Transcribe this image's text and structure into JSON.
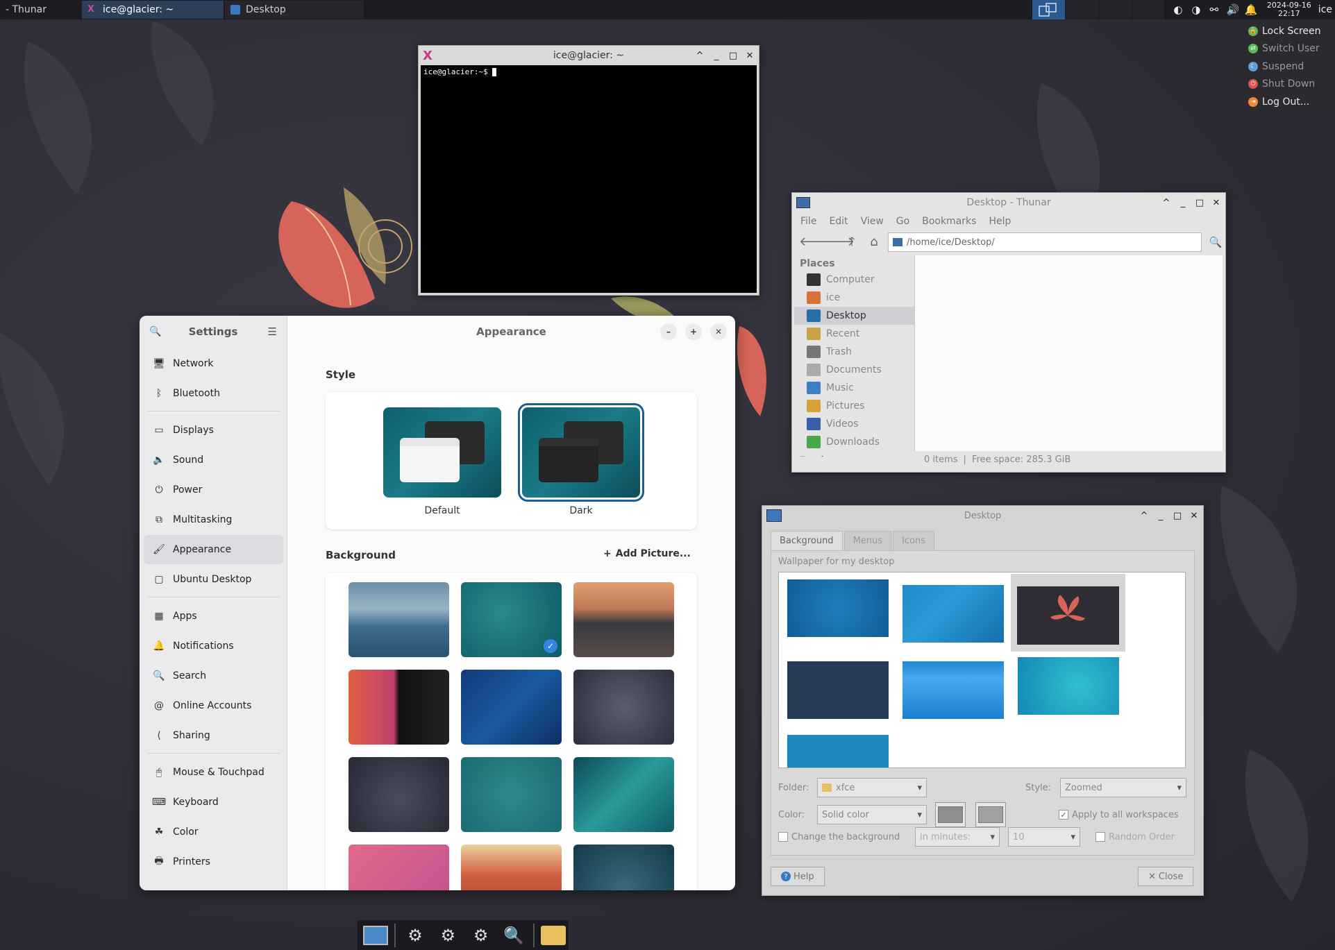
{
  "panel": {
    "tasks": [
      {
        "label": "- Thunar",
        "active": false
      },
      {
        "label": "ice@glacier: ~",
        "active": true
      },
      {
        "label": "Desktop",
        "active": false
      }
    ],
    "clock_date": "2024-09-16",
    "clock_time": "22:17",
    "user": "ice",
    "action_menu": [
      {
        "label": "Lock Screen",
        "color": "#5cb85c",
        "dim": false
      },
      {
        "label": "Switch User",
        "color": "#5cb85c",
        "dim": true
      },
      {
        "label": "Suspend",
        "color": "#5aa0d8",
        "dim": true
      },
      {
        "label": "Shut Down",
        "color": "#d9534f",
        "dim": true
      },
      {
        "label": "Log Out...",
        "color": "#f0883a",
        "dim": false
      }
    ]
  },
  "terminal": {
    "title": "ice@glacier: ~",
    "prompt": "ice@glacier:~$ "
  },
  "thunar": {
    "title": "Desktop - Thunar",
    "menu": [
      "File",
      "Edit",
      "View",
      "Go",
      "Bookmarks",
      "Help"
    ],
    "location": "/home/ice/Desktop/",
    "places_header": "Places",
    "places": [
      {
        "label": "Computer",
        "color": "#333",
        "icon": "computer-icon"
      },
      {
        "label": "ice",
        "color": "#d8743a",
        "icon": "home-icon"
      },
      {
        "label": "Desktop",
        "color": "#2a6ea8",
        "icon": "desktop-icon",
        "selected": true
      },
      {
        "label": "Recent",
        "color": "#c9a24a",
        "icon": "recent-icon"
      },
      {
        "label": "Trash",
        "color": "#777",
        "icon": "trash-icon"
      },
      {
        "label": "Documents",
        "color": "#aaa",
        "icon": "documents-icon"
      },
      {
        "label": "Music",
        "color": "#3c7fc4",
        "icon": "music-icon"
      },
      {
        "label": "Pictures",
        "color": "#d8a23a",
        "icon": "pictures-icon"
      },
      {
        "label": "Videos",
        "color": "#3a5fa8",
        "icon": "videos-icon"
      },
      {
        "label": "Downloads",
        "color": "#4aa84a",
        "icon": "downloads-icon"
      }
    ],
    "devices_header": "Devices",
    "status_items": "0 items",
    "status_sep": "|",
    "status_free": "Free space: 285.3 GiB"
  },
  "desktop_settings": {
    "title": "Desktop",
    "tabs": [
      "Background",
      "Menus",
      "Icons"
    ],
    "wallpaper_label": "Wallpaper for my desktop",
    "folder_label": "Folder:",
    "folder_value": "xfce",
    "style_label": "Style:",
    "style_value": "Zoomed",
    "color_label": "Color:",
    "color_value": "Solid color",
    "apply_all": "Apply to all workspaces",
    "change_bg": "Change the background",
    "interval_unit": "in minutes:",
    "interval_value": "10",
    "random_order": "Random Order",
    "help": "Help",
    "close": "Close"
  },
  "settings": {
    "sidebar_title": "Settings",
    "page_title": "Appearance",
    "groups": [
      [
        {
          "label": "Network",
          "glyph": "🖥"
        },
        {
          "label": "Bluetooth",
          "glyph": "ᛒ"
        }
      ],
      [
        {
          "label": "Displays",
          "glyph": "▭"
        },
        {
          "label": "Sound",
          "glyph": "🔈"
        },
        {
          "label": "Power",
          "glyph": "⏻"
        },
        {
          "label": "Multitasking",
          "glyph": "⧉"
        },
        {
          "label": "Appearance",
          "glyph": "🖌",
          "active": true
        },
        {
          "label": "Ubuntu Desktop",
          "glyph": "▢"
        }
      ],
      [
        {
          "label": "Apps",
          "glyph": "▦"
        },
        {
          "label": "Notifications",
          "glyph": "🔔"
        },
        {
          "label": "Search",
          "glyph": "🔍"
        },
        {
          "label": "Online Accounts",
          "glyph": "@"
        },
        {
          "label": "Sharing",
          "glyph": "⟨"
        }
      ],
      [
        {
          "label": "Mouse & Touchpad",
          "glyph": "🖱"
        },
        {
          "label": "Keyboard",
          "glyph": "⌨"
        },
        {
          "label": "Color",
          "glyph": "☘"
        },
        {
          "label": "Printers",
          "glyph": "🖶"
        }
      ]
    ],
    "style_section": "Style",
    "style_default": "Default",
    "style_dark": "Dark",
    "background_section": "Background",
    "add_picture": "Add Picture..."
  }
}
